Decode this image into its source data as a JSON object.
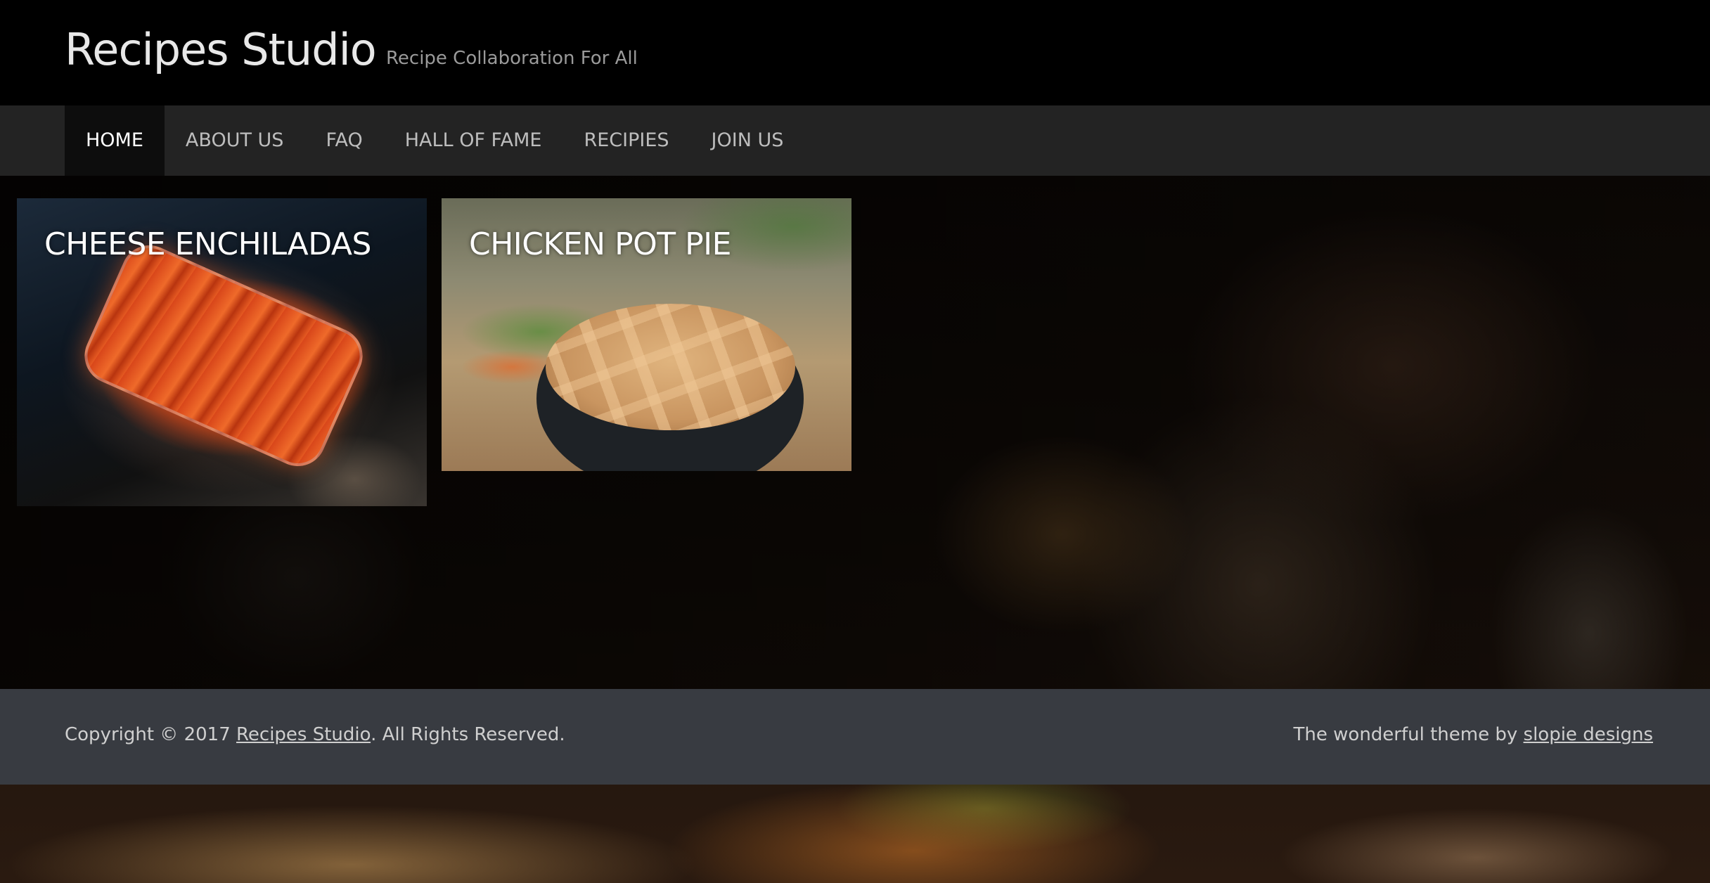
{
  "header": {
    "site_title": "Recipes Studio",
    "tagline": "Recipe Collaboration For All"
  },
  "nav": {
    "items": [
      {
        "label": "HOME",
        "active": true
      },
      {
        "label": "ABOUT US",
        "active": false
      },
      {
        "label": "FAQ",
        "active": false
      },
      {
        "label": "HALL OF FAME",
        "active": false
      },
      {
        "label": "RECIPIES",
        "active": false
      },
      {
        "label": "JOIN US",
        "active": false
      }
    ]
  },
  "recipes": [
    {
      "title": "CHEESE ENCHILADAS",
      "image": "enchiladas-photo"
    },
    {
      "title": "CHICKEN POT PIE",
      "image": "pot-pie-photo"
    }
  ],
  "footer": {
    "copyright_prefix": "Copyright © 2017 ",
    "copyright_link": "Recipes Studio",
    "copyright_suffix": ". All Rights Reserved.",
    "theme_prefix": "The wonderful theme by ",
    "theme_link": "slopie designs"
  },
  "colors": {
    "header_bg": "#000000",
    "nav_bg": "#232323",
    "nav_active_bg": "#0d0d0d",
    "footer_bg": "#383b41"
  }
}
